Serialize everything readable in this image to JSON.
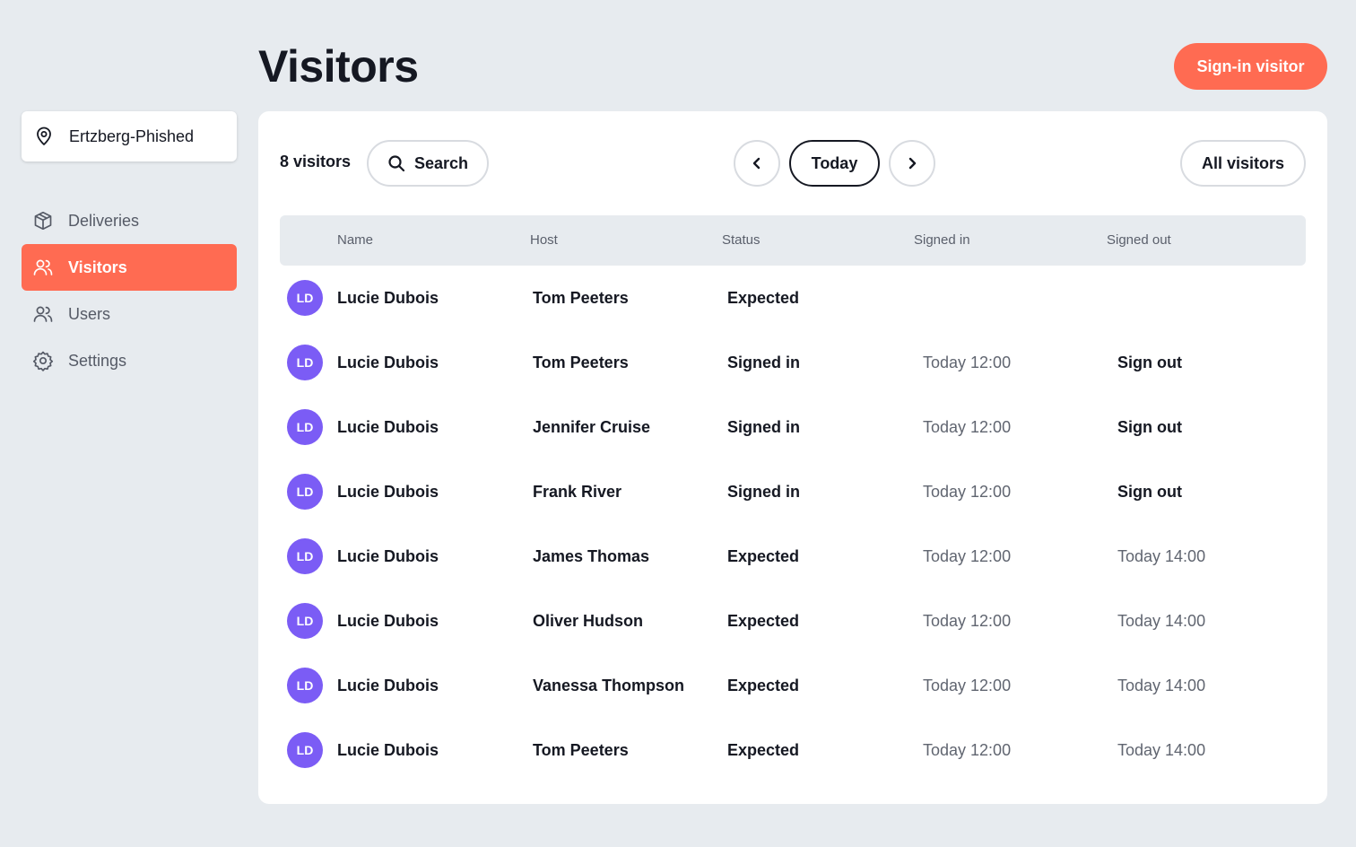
{
  "header": {
    "title": "Visitors",
    "primary_button": "Sign-in visitor"
  },
  "sidebar": {
    "location": "Ertzberg-Phished",
    "items": [
      {
        "label": "Deliveries",
        "icon": "box-icon",
        "active": false
      },
      {
        "label": "Visitors",
        "icon": "users-icon",
        "active": true
      },
      {
        "label": "Users",
        "icon": "users-icon",
        "active": false
      },
      {
        "label": "Settings",
        "icon": "gear-icon",
        "active": false
      }
    ]
  },
  "toolbar": {
    "count": "8 visitors",
    "search_label": "Search",
    "today_label": "Today",
    "filter_label": "All visitors"
  },
  "table": {
    "columns": [
      "Name",
      "Host",
      "Status",
      "Signed in",
      "Signed out"
    ],
    "rows": [
      {
        "initials": "LD",
        "name": "Lucie Dubois",
        "host": "Tom Peeters",
        "status": "Expected",
        "signed_in": "",
        "signed_out": "",
        "signed_out_action": false
      },
      {
        "initials": "LD",
        "name": "Lucie Dubois",
        "host": "Tom Peeters",
        "status": "Signed in",
        "signed_in": "Today 12:00",
        "signed_out": "Sign out",
        "signed_out_action": true
      },
      {
        "initials": "LD",
        "name": "Lucie Dubois",
        "host": "Jennifer Cruise",
        "status": "Signed in",
        "signed_in": "Today 12:00",
        "signed_out": "Sign out",
        "signed_out_action": true
      },
      {
        "initials": "LD",
        "name": "Lucie Dubois",
        "host": "Frank River",
        "status": "Signed in",
        "signed_in": "Today 12:00",
        "signed_out": "Sign out",
        "signed_out_action": true
      },
      {
        "initials": "LD",
        "name": "Lucie Dubois",
        "host": "James Thomas",
        "status": "Expected",
        "signed_in": "Today 12:00",
        "signed_out": "Today 14:00",
        "signed_out_action": false
      },
      {
        "initials": "LD",
        "name": "Lucie Dubois",
        "host": "Oliver Hudson",
        "status": "Expected",
        "signed_in": "Today 12:00",
        "signed_out": "Today 14:00",
        "signed_out_action": false
      },
      {
        "initials": "LD",
        "name": "Lucie Dubois",
        "host": "Vanessa Thompson",
        "status": "Expected",
        "signed_in": "Today 12:00",
        "signed_out": "Today 14:00",
        "signed_out_action": false
      },
      {
        "initials": "LD",
        "name": "Lucie Dubois",
        "host": "Tom Peeters",
        "status": "Expected",
        "signed_in": "Today 12:00",
        "signed_out": "Today 14:00",
        "signed_out_action": false
      }
    ]
  },
  "colors": {
    "accent": "#ff6b52",
    "avatar": "#7b5cf5",
    "background": "#e7ebef"
  }
}
